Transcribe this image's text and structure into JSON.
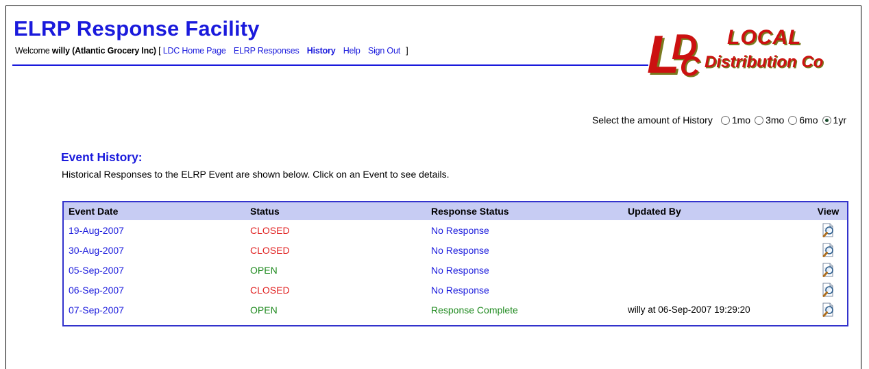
{
  "header": {
    "app_title": "ELRP Response Facility",
    "welcome_prefix": "Welcome",
    "welcome_user": "willy (Atlantic Grocery Inc)",
    "bracket_open": "[",
    "bracket_close": "]",
    "nav": [
      {
        "label": "LDC Home Page"
      },
      {
        "label": "ELRP Responses"
      },
      {
        "label": "History",
        "active": true
      },
      {
        "label": "Help"
      },
      {
        "label": "Sign Out"
      }
    ]
  },
  "logo": {
    "monogram": "LDC",
    "line1": "LOCAL",
    "line2": "Distribution Co"
  },
  "history_selector": {
    "label": "Select the amount of History",
    "options": [
      "1mo",
      "3mo",
      "6mo",
      "1yr"
    ],
    "selected": "1yr"
  },
  "event_history": {
    "title": "Event History:",
    "description": "Historical Responses to the ELRP Event are shown below. Click on an Event to see details.",
    "columns": [
      "Event Date",
      "Status",
      "Response Status",
      "Updated By",
      "View"
    ],
    "rows": [
      {
        "date": "19-Aug-2007",
        "status": "CLOSED",
        "response": "No Response",
        "updated_by": ""
      },
      {
        "date": "30-Aug-2007",
        "status": "CLOSED",
        "response": "No Response",
        "updated_by": ""
      },
      {
        "date": "05-Sep-2007",
        "status": "OPEN",
        "response": "No Response",
        "updated_by": ""
      },
      {
        "date": "06-Sep-2007",
        "status": "CLOSED",
        "response": "No Response",
        "updated_by": ""
      },
      {
        "date": "07-Sep-2007",
        "status": "OPEN",
        "response": "Response Complete",
        "updated_by": "willy at 06-Sep-2007 19:29:20"
      }
    ]
  },
  "colors": {
    "primary_blue": "#1a1adc",
    "closed_red": "#e02020",
    "open_green": "#1f8a1f",
    "header_band": "#c7ccf3",
    "logo_red": "#cc1111"
  },
  "icons": {
    "view": "magnifier-document-icon"
  }
}
